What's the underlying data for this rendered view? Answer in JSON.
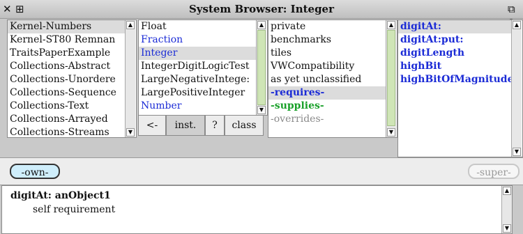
{
  "window": {
    "title": "System Browser: Integer",
    "close_glyph": "✕",
    "menu_glyph": "⊞",
    "right_glyph": "⧉ c"
  },
  "packages": {
    "items": [
      "Kernel-Numbers",
      "Kernel-ST80 Remnan",
      "TraitsPaperExample",
      "Collections-Abstract",
      "Collections-Unordere",
      "Collections-Sequence",
      "Collections-Text",
      "Collections-Arrayed",
      "Collections-Streams"
    ],
    "selected_index": 0
  },
  "classes": {
    "items": [
      {
        "label": "Float",
        "color": "#111111"
      },
      {
        "label": "Fraction",
        "color": "#1b2bd6"
      },
      {
        "label": "Integer",
        "color": "#1b2bd6"
      },
      {
        "label": "IntegerDigitLogicTest",
        "color": "#111111"
      },
      {
        "label": "LargeNegativeIntege:",
        "color": "#111111"
      },
      {
        "label": "LargePositiveInteger",
        "color": "#111111"
      },
      {
        "label": "Number",
        "color": "#1b2bd6"
      }
    ],
    "selected_index": 2
  },
  "categories": {
    "items": [
      {
        "label": "private",
        "style": "normal"
      },
      {
        "label": "benchmarks",
        "style": "normal"
      },
      {
        "label": "tiles",
        "style": "normal"
      },
      {
        "label": "VWCompatibility",
        "style": "normal"
      },
      {
        "label": "as yet unclassified",
        "style": "normal"
      },
      {
        "label": "-requires-",
        "style": "blue-bold"
      },
      {
        "label": "-supplies-",
        "style": "green-bold"
      },
      {
        "label": "-overrides-",
        "style": "gray"
      }
    ],
    "selected_index": 5
  },
  "methods": {
    "items": [
      "digitAt:",
      "digitAt:put:",
      "digitLength",
      "highBit",
      "highBitOfMagnitude"
    ],
    "selected_index": 0
  },
  "buttons": {
    "arrow": "<-",
    "inst": "inst.",
    "help": "?",
    "class": "class"
  },
  "modes": {
    "own": "-own-",
    "super": "-super-"
  },
  "code": {
    "signature": "digitAt: anObject1",
    "body": "self requirement"
  },
  "colors": {
    "selection": "#dcdcdc",
    "scroll_thumb": "#cfe5b6",
    "own_pill": "#cfeefb",
    "blue_text": "#1b2bd6",
    "green_text": "#1aa12a"
  }
}
